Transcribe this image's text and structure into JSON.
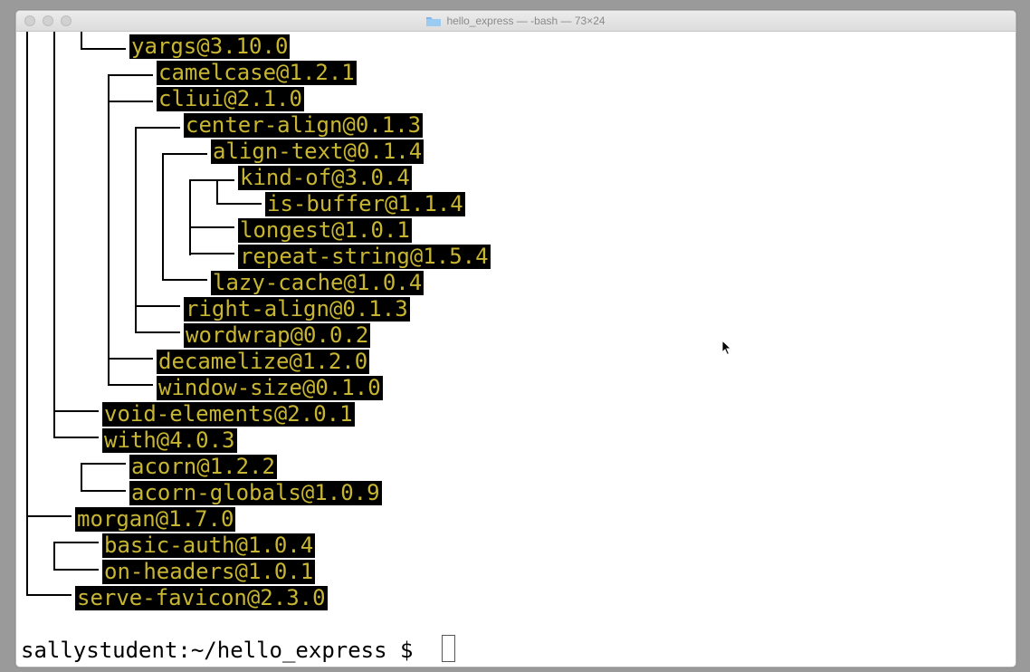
{
  "window": {
    "title": "hello_express — -bash — 73×24",
    "title_icon": "folder-icon"
  },
  "terminal": {
    "prompt": "sallystudent:~/hello_express $ ",
    "packages": [
      "yargs@3.10.0",
      "camelcase@1.2.1",
      "cliui@2.1.0",
      "center-align@0.1.3",
      "align-text@0.1.4",
      "kind-of@3.0.4",
      "is-buffer@1.1.4",
      "longest@1.0.1",
      "repeat-string@1.5.4",
      "lazy-cache@1.0.4",
      "right-align@0.1.3",
      "wordwrap@0.0.2",
      "decamelize@1.2.0",
      "window-size@0.1.0",
      "void-elements@2.0.1",
      "with@4.0.3",
      "acorn@1.2.2",
      "acorn-globals@1.0.9",
      "morgan@1.7.0",
      "basic-auth@1.0.4",
      "on-headers@1.0.1",
      "serve-favicon@2.3.0"
    ]
  },
  "colors": {
    "highlight_bg": "#000000",
    "highlight_fg": "#c8b632",
    "terminal_bg": "#ffffff"
  }
}
